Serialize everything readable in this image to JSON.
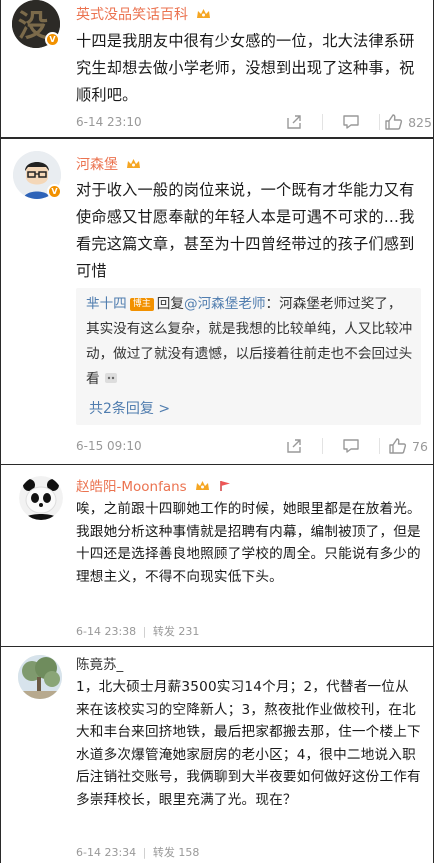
{
  "comments": [
    {
      "username": "英式没品笑话百科",
      "text": "十四是我朋友中很有少女感的一位，北大法律系研究生却想去做小学老师，没想到出现了这种事，祝顺利吧。",
      "time": "6-14 23:10",
      "like_count": "825"
    },
    {
      "username": "河森堡",
      "text": "对于收入一般的岗位来说，一个既有才华能力又有使命感又甘愿奉献的年轻人本是可遇不可求的…我看完这篇文章，甚至为十四曾经带过的孩子们感到可惜",
      "reply": {
        "author": "芈十四",
        "author_tag": "博主",
        "reply_word": "回复",
        "mention": "@河森堡老师",
        "text": "：河森堡老师过奖了，其实没有这么复杂，就是我想的比较单纯，人又比较冲动，做过了就没有遗憾，以后接着往前走也不会回过头看"
      },
      "more_replies": "共2条回复 >",
      "time": "6-15 09:10",
      "like_count": "76"
    },
    {
      "username": "赵皓阳-Moonfans",
      "text": "唉，之前跟十四聊她工作的时候，她眼里都是在放着光。我跟她分析这种事情就是招聘有内幕，编制被顶了，但是十四还是选择善良地照顾了学校的周全。只能说有多少的理想主义，不得不向现实低下头。",
      "time": "6-14 23:38",
      "repost_label": "转发",
      "repost_count": "231"
    },
    {
      "username": "陈竟苏_",
      "text": "1，北大硕士月薪3500实习14个月；2，代替者一位从来在该校实习的空降新人；3，熬夜批作业做校刊，在北大和丰台来回挤地铁，最后把家都搬去那，住一个楼上下水道多次爆管淹她家厨房的老小区；4，很中二地说入职后注销社交账号，我俩聊到大半夜要如何做好这份工作有多崇拜校长，眼里充满了光。现在？",
      "time": "6-14 23:34",
      "repost_label": "转发",
      "repost_count": "158"
    }
  ],
  "icons": {
    "share": "share-icon",
    "comment": "comment-icon",
    "like": "thumbs-up-icon",
    "crown": "crown-icon",
    "verified": "verified-badge-icon",
    "emoji": "emoji-icon",
    "flag": "flag-icon"
  },
  "colors": {
    "username_vip": "#eb7350",
    "link_blue": "#507daf",
    "verified_badge": "#f29100",
    "meta_gray": "#999999"
  }
}
